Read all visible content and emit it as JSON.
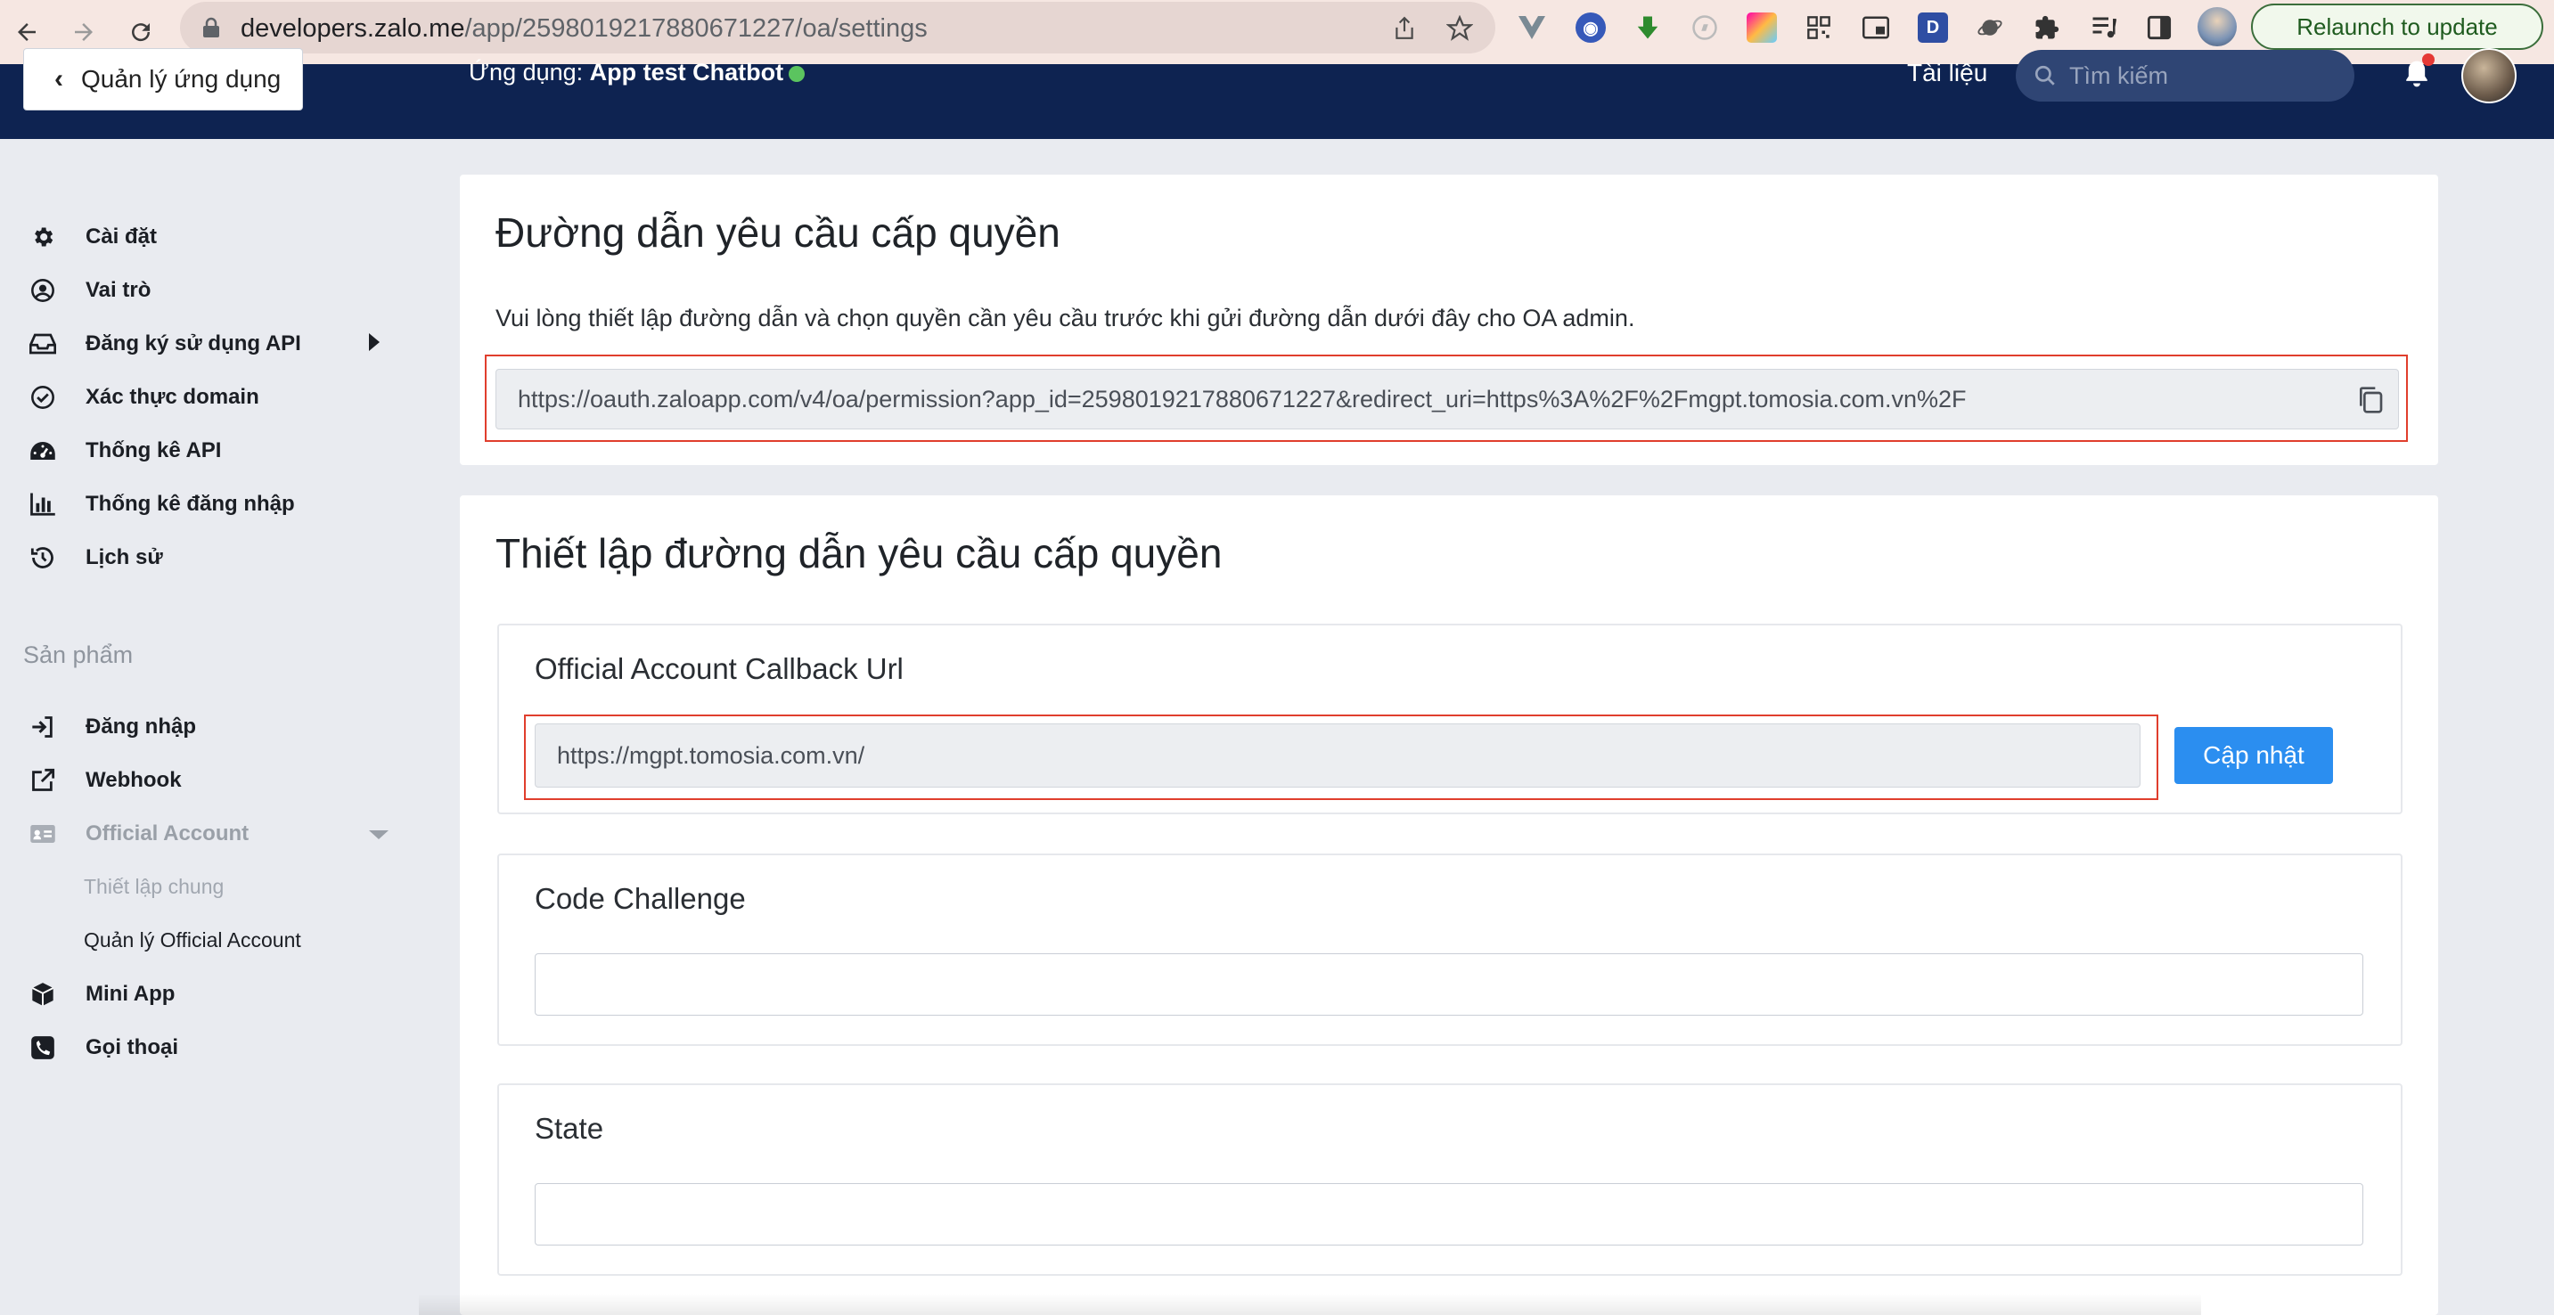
{
  "browser": {
    "url_domain": "developers.zalo.me",
    "url_path": "/app/2598019217880671227/oa/settings",
    "relaunch_label": "Relaunch to update"
  },
  "header": {
    "back_label": "Quản lý ứng dụng",
    "app_prefix": "Ứng dụng: ",
    "app_name": "App test Chatbot",
    "docs_label": "Tài liệu",
    "search_placeholder": "Tìm kiếm"
  },
  "sidebar": {
    "items": [
      {
        "label": "Cài đặt",
        "icon": "gear-icon"
      },
      {
        "label": "Vai trò",
        "icon": "user-circle-icon"
      },
      {
        "label": "Đăng ký sử dụng API",
        "icon": "inbox-icon"
      },
      {
        "label": "Xác thực domain",
        "icon": "check-circle-icon"
      },
      {
        "label": "Thống kê API",
        "icon": "dashboard-icon"
      },
      {
        "label": "Thống kê đăng nhập",
        "icon": "bar-chart-icon"
      },
      {
        "label": "Lịch sử",
        "icon": "history-icon"
      }
    ],
    "section_products": "Sản phẩm",
    "products": [
      {
        "label": "Đăng nhập",
        "icon": "sign-in-icon"
      },
      {
        "label": "Webhook",
        "icon": "external-link-icon"
      },
      {
        "label": "Official Account",
        "icon": "id-card-icon"
      }
    ],
    "oa_sub": [
      "Thiết lập chung",
      "Quản lý Official Account"
    ],
    "more": [
      {
        "label": "Mini App",
        "icon": "cube-icon"
      },
      {
        "label": "Gọi thoại",
        "icon": "phone-icon"
      }
    ]
  },
  "permission_card": {
    "title": "Đường dẫn yêu cầu cấp quyền",
    "description": "Vui lòng thiết lập đường dẫn và chọn quyền cần yêu cầu trước khi gửi đường dẫn dưới đây cho OA admin.",
    "url": "https://oauth.zaloapp.com/v4/oa/permission?app_id=2598019217880671227&redirect_uri=https%3A%2F%2Fmgpt.tomosia.com.vn%2F"
  },
  "settings_card": {
    "title": "Thiết lập đường dẫn yêu cầu cấp quyền",
    "callback_label": "Official Account Callback Url",
    "callback_value": "https://mgpt.tomosia.com.vn/",
    "update_label": "Cập nhật",
    "code_challenge_label": "Code Challenge",
    "code_challenge_value": "",
    "state_label": "State",
    "state_value": ""
  },
  "colors": {
    "header_bg": "#0e2351",
    "accent": "#2b8ef0",
    "highlight_border": "#e03e2d",
    "status_online": "#5bc45f"
  }
}
